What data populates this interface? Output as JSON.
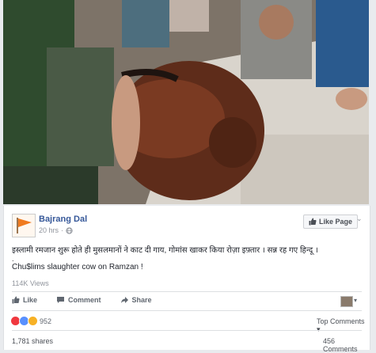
{
  "video": {
    "description_icon": "video-frame"
  },
  "post": {
    "page_name": "Bajrang Dal",
    "time": "20 hrs",
    "like_page_label": "Like Page",
    "text_hindi": "इस्लामी रमजान शुरू होते ही मुसलमानों ने काट दी गाय, गोमांस खाकर किया रोज़ा इफ़्तार । सन्न रह गए हिन्दू ।",
    "text_dot": ".",
    "text_english": "Chu$lims slaughter cow on Ramzan !",
    "views": "114K Views"
  },
  "actions": {
    "like": "Like",
    "comment": "Comment",
    "share": "Share"
  },
  "stats": {
    "reactions_count": "952",
    "top_comments": "Top Comments",
    "shares": "1,781 shares",
    "comments": "456 Comments"
  }
}
